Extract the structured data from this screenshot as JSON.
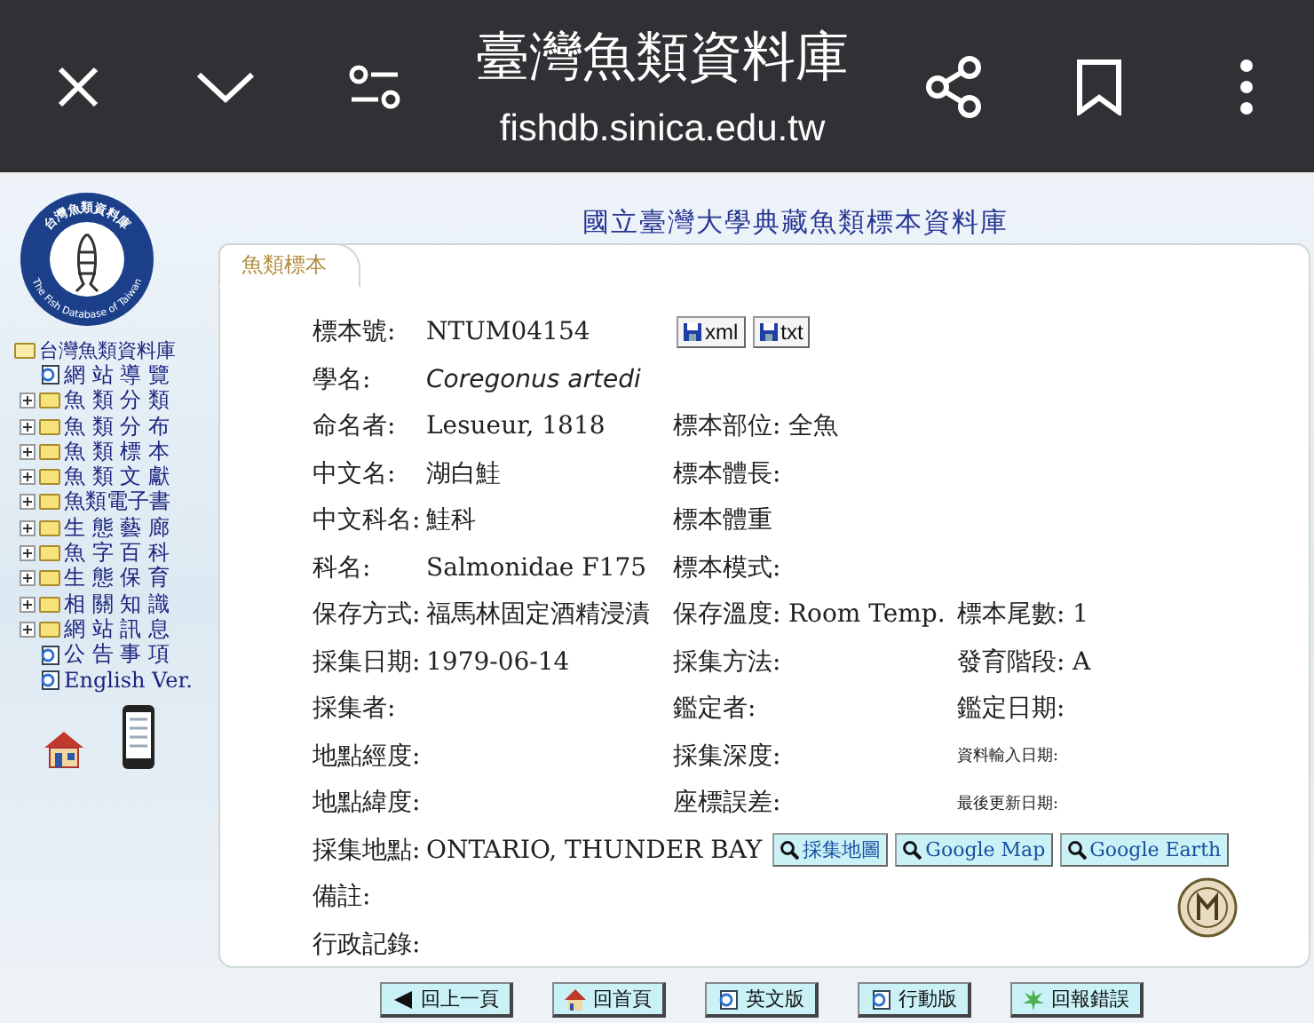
{
  "browser_bar": {
    "title": "臺灣魚類資料庫",
    "url": "fishdb.sinica.edu.tw"
  },
  "logo": {
    "top_text": "台灣魚類資料庫",
    "ring_text": "The Fish Database of Taiwan"
  },
  "sidebar": {
    "root": {
      "label": "台灣魚類資料庫",
      "expanded": true
    },
    "items": [
      {
        "kind": "page",
        "label": "網 站 導 覽"
      },
      {
        "kind": "folder",
        "label": "魚 類 分 類",
        "expanded": false
      },
      {
        "kind": "folder",
        "label": "魚 類 分 布",
        "expanded": false
      },
      {
        "kind": "folder",
        "label": "魚 類 標 本",
        "expanded": false
      },
      {
        "kind": "folder",
        "label": "魚 類 文 獻",
        "expanded": false
      },
      {
        "kind": "folder",
        "label": "魚類電子書",
        "expanded": false
      },
      {
        "kind": "folder",
        "label": "生 態 藝 廊",
        "expanded": false
      },
      {
        "kind": "folder",
        "label": "魚 字 百 科",
        "expanded": false
      },
      {
        "kind": "folder",
        "label": "生 態 保 育",
        "expanded": false
      },
      {
        "kind": "folder",
        "label": "相 關 知 識",
        "expanded": false
      },
      {
        "kind": "folder",
        "label": "網 站 訊 息",
        "expanded": false
      },
      {
        "kind": "page",
        "label": "公 告 事 項"
      },
      {
        "kind": "page",
        "label": "English Ver."
      }
    ]
  },
  "page_title": "國立臺灣大學典藏魚類標本資料庫",
  "tab": {
    "label": "魚類標本",
    "selected": true
  },
  "rows": [
    {
      "fields": [
        {
          "label": "標本號:",
          "value": "NTUM04154"
        }
      ],
      "buttons": [
        {
          "kind": "save",
          "label": "xml"
        },
        {
          "kind": "save",
          "label": "txt"
        }
      ]
    },
    {
      "fields": [
        {
          "label": "學名:",
          "value": "Coregonus artedi",
          "kind": "italic"
        }
      ]
    },
    {
      "fields": [
        {
          "label": "命名者:",
          "value": "Lesueur, 1818"
        },
        {
          "label": "標本部位:",
          "value": "全魚"
        }
      ]
    },
    {
      "fields": [
        {
          "label": "中文名:",
          "value": "湖白鮭"
        },
        {
          "label": "標本體長:"
        }
      ]
    },
    {
      "fields": [
        {
          "label": "中文科名:",
          "value": "鮭科"
        },
        {
          "label": "標本體重"
        }
      ]
    },
    {
      "fields": [
        {
          "label": "科名:",
          "value": "Salmonidae  F175"
        },
        {
          "label": "標本模式:"
        }
      ]
    },
    {
      "fields": [
        {
          "label": "保存方式:",
          "value": "福馬林固定酒精浸漬"
        },
        {
          "label": "保存溫度:",
          "value": "Room Temp."
        },
        {
          "label": "標本尾數:",
          "value": "1"
        }
      ]
    },
    {
      "fields": [
        {
          "label": "採集日期:",
          "value": "1979-06-14"
        },
        {
          "label": "採集方法:"
        },
        {
          "label": "發育階段:",
          "value": "A"
        }
      ]
    },
    {
      "fields": [
        {
          "label": "採集者:"
        },
        {
          "label": "鑑定者:"
        },
        {
          "label": "鑑定日期:"
        }
      ]
    },
    {
      "fields": [
        {
          "label": "地點經度:"
        },
        {
          "label": "採集深度:"
        },
        {
          "label": "資料輸入日期:",
          "kind": "small"
        }
      ]
    },
    {
      "fields": [
        {
          "label": "地點緯度:"
        },
        {
          "label": "座標誤差:"
        },
        {
          "label": "最後更新日期:",
          "kind": "small"
        }
      ]
    },
    {
      "fields": [
        {
          "label": "採集地點:",
          "value": "ONTARIO, THUNDER BAY"
        }
      ],
      "buttons": [
        {
          "kind": "search",
          "label": "採集地圖"
        },
        {
          "kind": "search",
          "label": "Google Map"
        },
        {
          "kind": "search",
          "label": "Google Earth"
        }
      ]
    },
    {
      "fields": [
        {
          "label": "備註:"
        }
      ]
    },
    {
      "fields": [
        {
          "label": "行政記錄:"
        }
      ]
    }
  ],
  "nav_buttons": [
    {
      "kind": "back",
      "label": "回上一頁"
    },
    {
      "kind": "home",
      "label": "回首頁"
    },
    {
      "kind": "page",
      "label": "英文版"
    },
    {
      "kind": "page",
      "label": "行動版"
    },
    {
      "kind": "report",
      "label": "回報錯誤"
    }
  ]
}
